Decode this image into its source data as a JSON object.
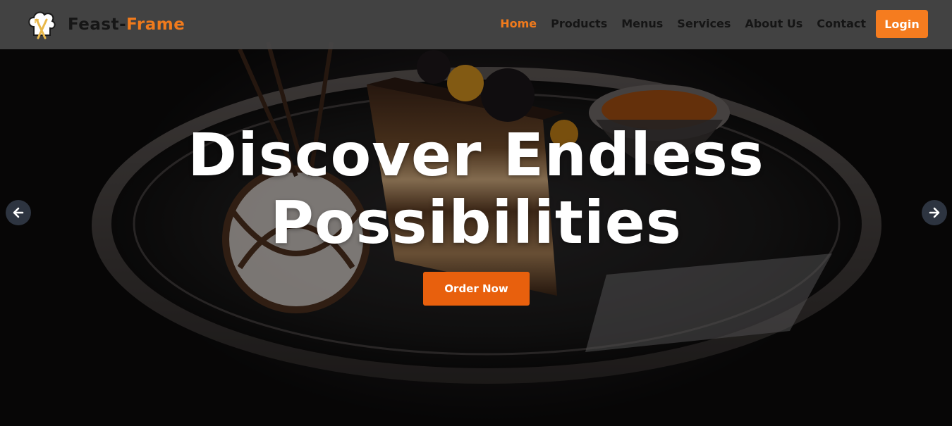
{
  "brand": {
    "name_part1": "Feast-",
    "name_part2": "Frame",
    "logo_icon": "chef-hat-utensils-icon",
    "accent_color": "#f07a1c"
  },
  "nav": {
    "items": [
      {
        "label": "Home",
        "active": true
      },
      {
        "label": "Products",
        "active": false
      },
      {
        "label": "Menus",
        "active": false
      },
      {
        "label": "Services",
        "active": false
      },
      {
        "label": "About Us",
        "active": false
      },
      {
        "label": "Contact",
        "active": false
      }
    ],
    "login_label": "Login"
  },
  "hero": {
    "headline_line1": "Discover Endless",
    "headline_line2": "Possibilities",
    "cta_label": "Order Now",
    "cta_color": "#e8600d",
    "prev_icon": "arrow-left-icon",
    "next_icon": "arrow-right-icon"
  }
}
